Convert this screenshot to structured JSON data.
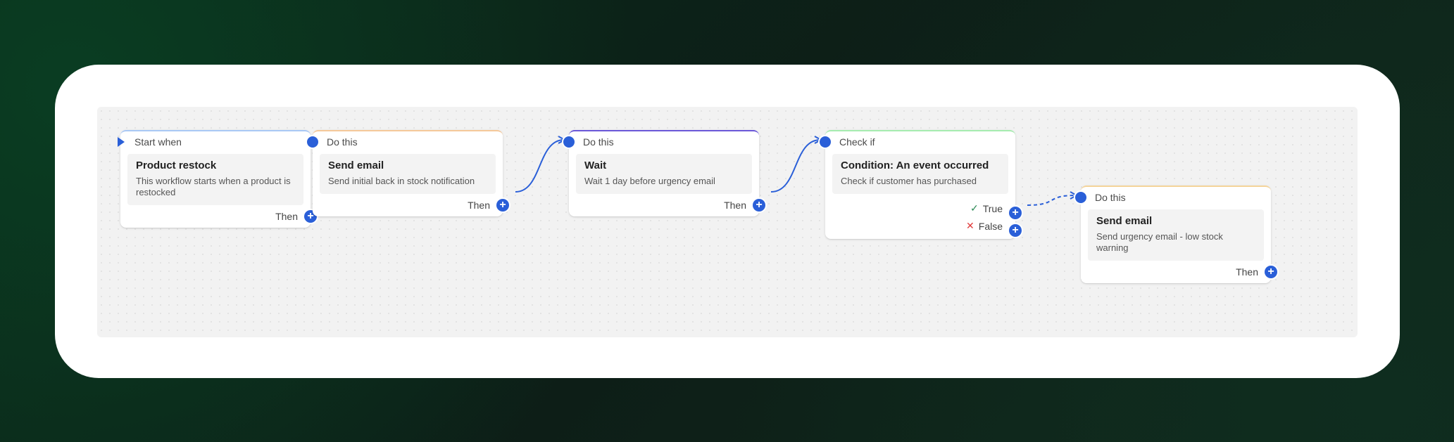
{
  "nodes": {
    "start": {
      "header": "Start when",
      "title": "Product restock",
      "desc": "This workflow starts when a product is restocked",
      "then": "Then",
      "color": "#a9c8f5"
    },
    "send1": {
      "header": "Do this",
      "title": "Send email",
      "desc": "Send initial back in stock notification",
      "then": "Then",
      "color": "#f5c89a"
    },
    "wait": {
      "header": "Do this",
      "title": "Wait",
      "desc": "Wait 1 day before urgency email",
      "then": "Then",
      "color": "#6a57d8"
    },
    "check": {
      "header": "Check if",
      "title": "Condition: An event occurred",
      "desc": "Check if customer has purchased",
      "true_label": "True",
      "false_label": "False",
      "color": "#a6ecb0"
    },
    "send2": {
      "header": "Do this",
      "title": "Send email",
      "desc": "Send urgency email - low stock warning",
      "then": "Then",
      "color": "#f5d49a"
    }
  },
  "icons": {
    "plus": "+",
    "check": "✓",
    "cross": "✕"
  },
  "colors": {
    "accent": "#2a5fd8"
  }
}
